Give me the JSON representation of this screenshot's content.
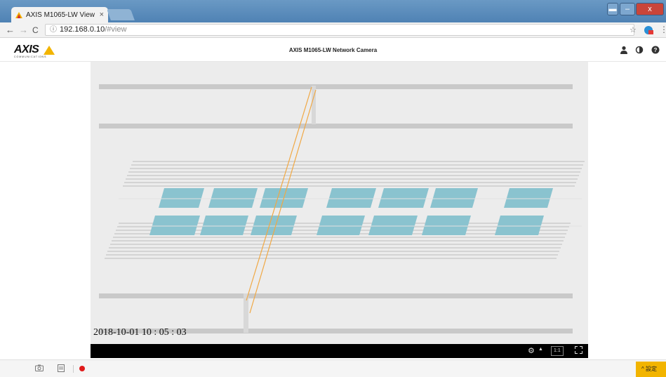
{
  "browser": {
    "tab_title": "AXIS M1065-LW View",
    "tab_close": "×",
    "address_host": "192.168.0.10",
    "address_path": "/#view",
    "back_glyph": "←",
    "forward_glyph": "→",
    "reload_glyph": "C",
    "info_glyph": "ⓘ",
    "star_glyph": "☆",
    "menu_glyph": "⋮",
    "icons": [
      "back-arrow-icon",
      "forward-arrow-icon",
      "reload-icon",
      "info-icon",
      "bookmark-star-icon",
      "extension-icon",
      "menu-icon"
    ]
  },
  "window_controls": {
    "restore": "▬",
    "minimize": "–",
    "close": "x"
  },
  "header": {
    "logo_text": "AXIS",
    "logo_sub": "COMMUNICATIONS",
    "title": "AXIS M1065-LW Network Camera",
    "icons": [
      "user-icon",
      "contrast-icon",
      "help-icon"
    ],
    "user_glyph": "👤",
    "contrast_glyph": "◑",
    "help_glyph": "?"
  },
  "viewer": {
    "timestamp": "2018-10-01 10 : 05 : 03",
    "zoom_label": "1:1",
    "gear_glyph": "⚙",
    "caret_glyph": "▲",
    "icons": [
      "settings-gear-icon",
      "expand-up-icon",
      "fullscreen-icon"
    ]
  },
  "bottom_bar": {
    "settings_label": "設定",
    "settings_caret": "^",
    "snapshot_glyph": "📷",
    "storage_glyph": "🖫",
    "icons": [
      "snapshot-icon",
      "storage-icon",
      "record-icon"
    ]
  },
  "colors": {
    "accent_yellow": "#f2b400",
    "panel_teal": "#8ac3cf",
    "wire_orange": "#f0a844",
    "titlebar_blue": "#5a8cbd",
    "record_red": "#e01b1b"
  }
}
